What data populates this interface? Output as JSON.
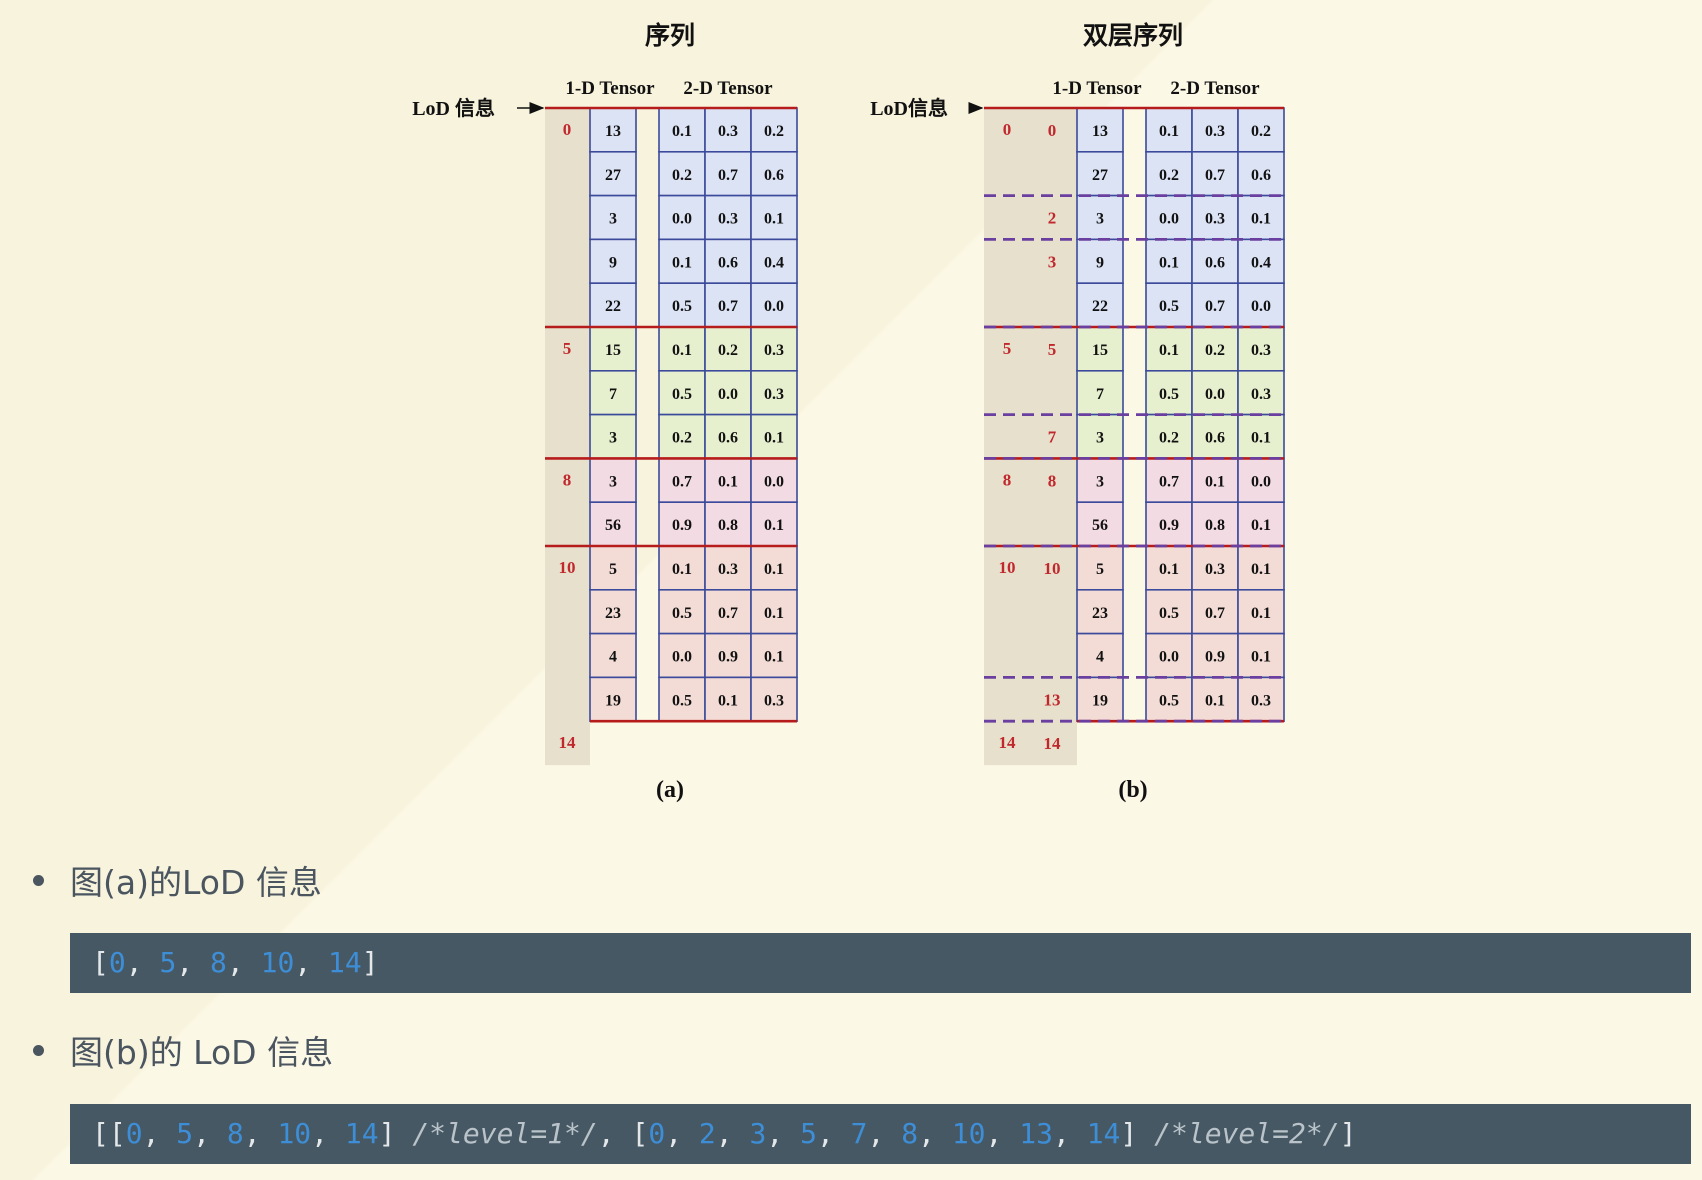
{
  "figure": {
    "left": {
      "title": "序列",
      "subtitle": "(a)",
      "col1_header": "1-D Tensor",
      "col2_header": "2-D Tensor",
      "lod_label": "LoD 信息",
      "lod_offsets": [
        "0",
        "5",
        "8",
        "10",
        "14"
      ]
    },
    "right": {
      "title": "双层序列",
      "subtitle": "(b)",
      "col1_header": "1-D Tensor",
      "col2_header": "2-D Tensor",
      "lod_label": "LoD信息",
      "level1_offsets": [
        "0",
        "5",
        "8",
        "10",
        "14"
      ],
      "level2_offsets": [
        "0",
        "2",
        "3",
        "5",
        "7",
        "8",
        "10",
        "13",
        "14"
      ]
    },
    "tensor_1d": [
      "13",
      "27",
      "3",
      "9",
      "22",
      "15",
      "7",
      "3",
      "3",
      "56",
      "5",
      "23",
      "4",
      "19"
    ],
    "tensor_2d": [
      [
        "0.1",
        "0.3",
        "0.2"
      ],
      [
        "0.2",
        "0.7",
        "0.6"
      ],
      [
        "0.0",
        "0.3",
        "0.1"
      ],
      [
        "0.1",
        "0.6",
        "0.4"
      ],
      [
        "0.5",
        "0.7",
        "0.0"
      ],
      [
        "0.1",
        "0.2",
        "0.3"
      ],
      [
        "0.5",
        "0.0",
        "0.3"
      ],
      [
        "0.2",
        "0.6",
        "0.1"
      ],
      [
        "0.7",
        "0.1",
        "0.0"
      ],
      [
        "0.9",
        "0.8",
        "0.1"
      ],
      [
        "0.1",
        "0.3",
        "0.1"
      ],
      [
        "0.5",
        "0.7",
        "0.1"
      ],
      [
        "0.0",
        "0.9",
        "0.1"
      ],
      [
        "0.5",
        "0.1",
        "0.3"
      ]
    ],
    "group_colors": [
      "#dce3f5",
      "#e6f0cf",
      "#f3dbe4",
      "#f3dcd6"
    ],
    "outline_colors": {
      "border_line": "#b71c1c",
      "cell_border": "#3b4a9a",
      "dashed": "#6a3fa0",
      "lod_text": "#c0282d"
    }
  },
  "bullets": [
    {
      "label": "图(a)的LoD 信息",
      "code": "[0, 5, 8, 10, 14]"
    },
    {
      "label": "图(b)的 LoD 信息",
      "code": "[[0, 5, 8, 10, 14] /*level=1*/, [0, 2, 3, 5, 7, 8, 10, 13, 14] /*level=2*/]"
    }
  ]
}
